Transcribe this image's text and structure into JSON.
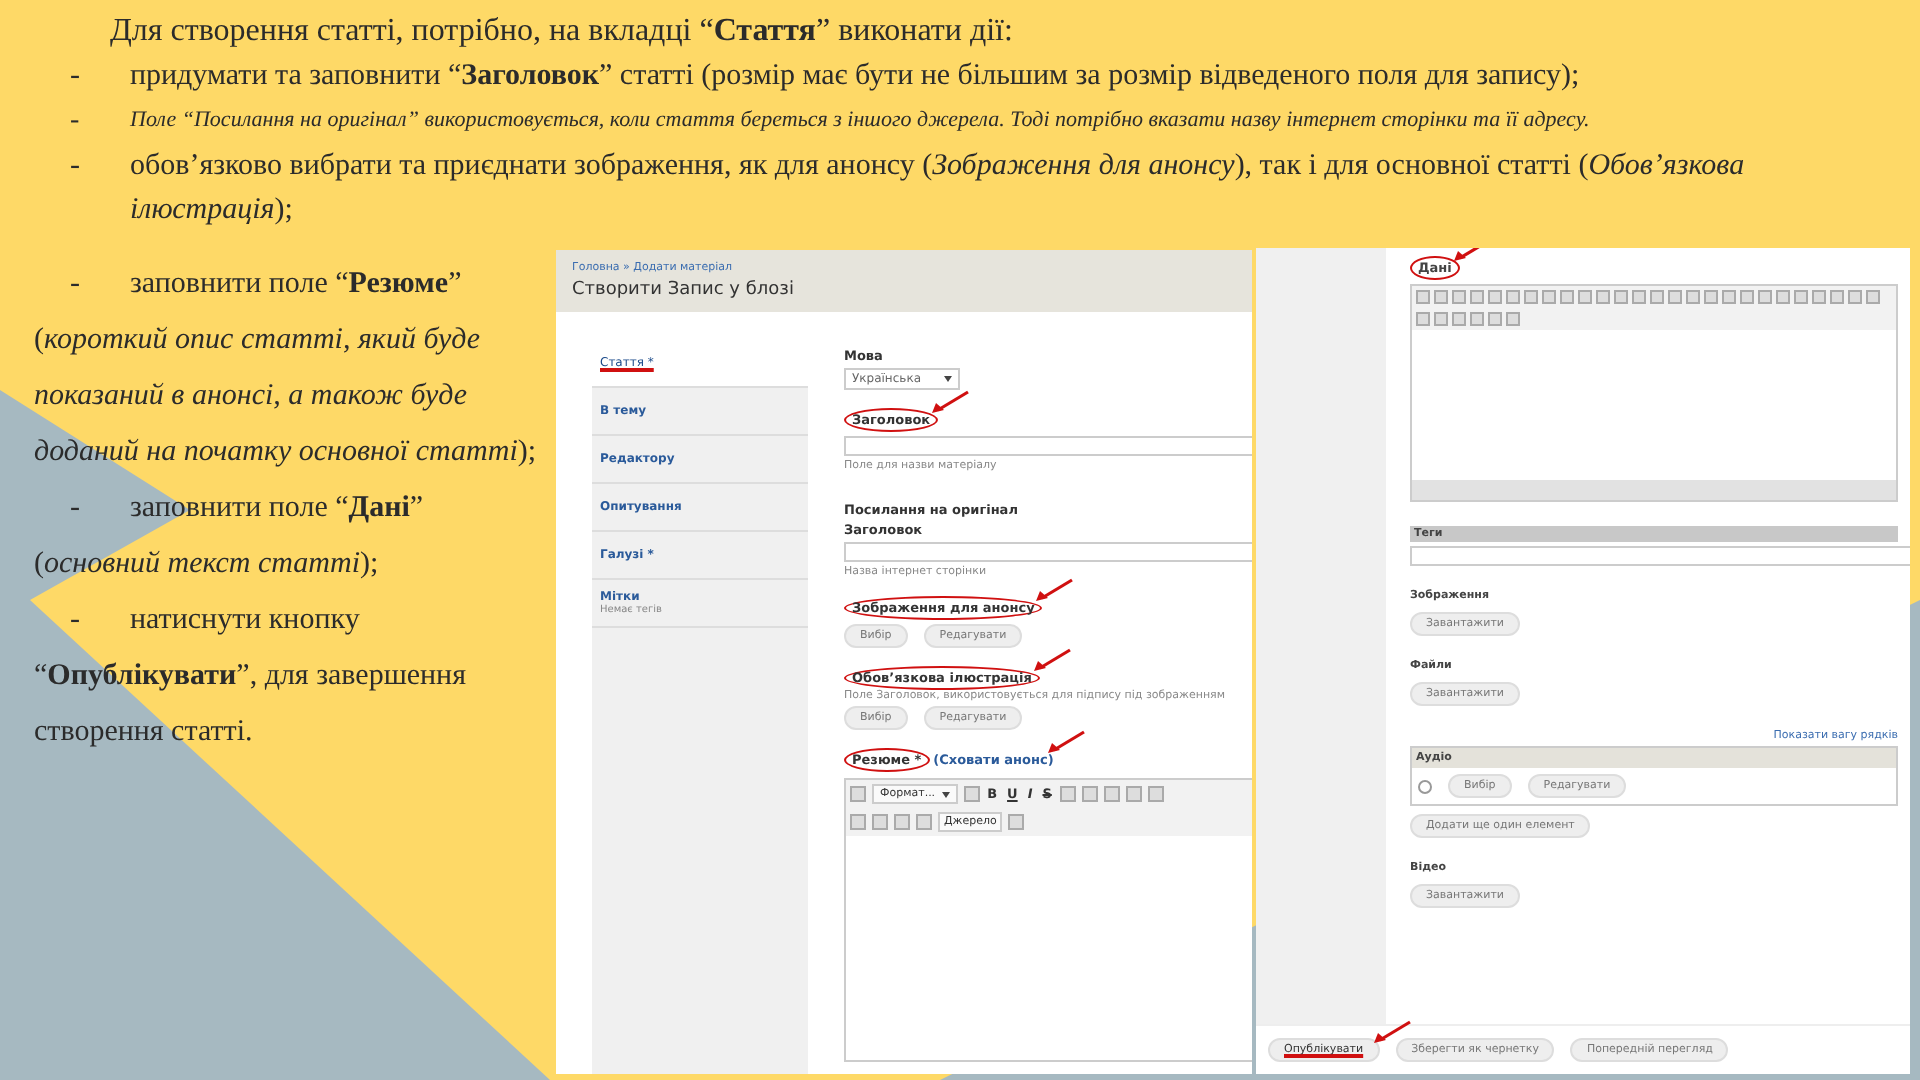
{
  "intro": "Для створення статті, потрібно, на вкладці “**Стаття**” виконати дії:",
  "bullets": [
    {
      "kind": "normal",
      "marker": "-",
      "text": "придумати та заповнити “**Заголовок**” статті (розмір має бути не більшим за розмір відведеного поля для запису);"
    },
    {
      "kind": "note",
      "marker": "-",
      "text": "Поле “Посилання на оригінал” використовується, коли стаття береться з іншого джерела. Тоді потрібно вказати назву інтернет сторінки та її адресу."
    },
    {
      "kind": "normal",
      "marker": "-",
      "text": "обов’язково вибрати та приєднати зображення, як для анонсу (*Зображення для анонсу*), так і для основної статті (*Обов’язкова ілюстрація*);"
    }
  ],
  "steps": [
    {
      "marker": "-",
      "text": "заповнити поле “**Резюме**”",
      "note": "(*короткий опис статті, який буде показаний в анонсі, а також буде доданий на початку основної статті*);"
    },
    {
      "marker": "-",
      "text": "заповнити поле “**Дані**”",
      "note": "(*основний текст статті*);"
    },
    {
      "marker": "-",
      "text": "натиснути кнопку",
      "note": "“**Опублікувати**”, для завершення створення статті."
    }
  ],
  "form": {
    "breadcrumb": "Головна » Додати матеріал",
    "title": "Створити Запис у блозі",
    "tabs": [
      {
        "label": "Стаття *",
        "selected": true
      },
      {
        "label": "В тему",
        "selected": false
      },
      {
        "label": "Редактору",
        "selected": false
      },
      {
        "label": "Опитування",
        "selected": false
      },
      {
        "label": "Галузі *",
        "selected": false
      },
      {
        "label": "Мітки",
        "sub": "Немає тегів",
        "selected": false
      }
    ],
    "fields": [
      {
        "kind": "select",
        "label": "Мова",
        "value": "Українська",
        "circled": false
      },
      {
        "kind": "text",
        "label": "Заголовок",
        "circled": true,
        "hint": "Поле для назви матеріалу"
      },
      {
        "kind": "section",
        "label": "Посилання на оригінал"
      },
      {
        "kind": "text",
        "label": "Заголовок",
        "circled": false,
        "hint": "Назва інтернет сторінки"
      },
      {
        "kind": "image",
        "label": "Зображення для анонсу",
        "circled": true,
        "buttons": [
          "Вибір",
          "Редагувати"
        ]
      },
      {
        "kind": "image",
        "label": "Обов’язкова ілюстрація",
        "circled": true,
        "hint": "Поле Заголовок, використовується для підпису під зображенням",
        "buttons": [
          "Вибір",
          "Редагувати"
        ]
      },
      {
        "kind": "editor",
        "label": "Резюме *",
        "circled": true,
        "link": "(Сховати анонс)",
        "format": "Формат...",
        "marks": [
          "B",
          "U",
          "I",
          "S"
        ],
        "source": "Джерело"
      }
    ]
  },
  "form2": {
    "sections": [
      {
        "kind": "editor",
        "label": "Дані",
        "circled": true
      },
      {
        "kind": "tags",
        "label": "Теги"
      },
      {
        "kind": "upload",
        "label": "Зображення",
        "button": "Завантажити"
      },
      {
        "kind": "upload",
        "label": "Файли",
        "button": "Завантажити"
      },
      {
        "kind": "table",
        "link": "Показати вагу рядків",
        "header": "Аудіо",
        "buttons": [
          "Вибір",
          "Редагувати"
        ],
        "button": "Додати ще один елемент"
      },
      {
        "kind": "upload",
        "label": "Відео",
        "button": "Завантажити"
      }
    ],
    "actions": [
      {
        "label": "Опублікувати",
        "underlined": true
      },
      {
        "label": "Зберегти як чернетку",
        "underlined": false
      },
      {
        "label": "Попередній перегляд",
        "underlined": false
      }
    ]
  }
}
